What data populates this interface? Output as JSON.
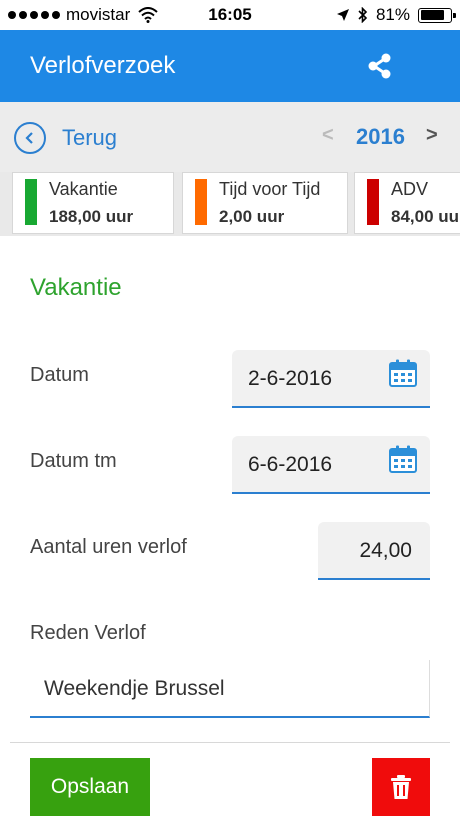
{
  "status_bar": {
    "carrier": "movistar",
    "time": "16:05",
    "battery": "81%",
    "battery_level": 0.81
  },
  "header": {
    "title": "Verlofverzoek",
    "share_icon": "share-icon"
  },
  "nav": {
    "back_label": "Terug",
    "year": "2016",
    "prev": "<",
    "next": ">"
  },
  "cards": [
    {
      "name": "Vakantie",
      "value": "188,00 uur",
      "color": "#18a832"
    },
    {
      "name": "Tijd voor Tijd",
      "value": "2,00 uur",
      "color": "#ff6a00"
    },
    {
      "name": "ADV",
      "value": "84,00 uur",
      "color": "#cc0000"
    }
  ],
  "form": {
    "section_title": "Vakantie",
    "datum_label": "Datum",
    "datum_value": "2-6-2016",
    "datum_tm_label": "Datum tm",
    "datum_tm_value": "6-6-2016",
    "uren_label": "Aantal uren verlof",
    "uren_value": "24,00",
    "reden_label": "Reden Verlof",
    "reden_value": "Weekendje Brussel"
  },
  "actions": {
    "save_label": "Opslaan",
    "delete_icon": "trash-icon"
  },
  "colors": {
    "header": "#1e88e5",
    "accent": "#2b7fd0",
    "section": "#2ea32e",
    "save": "#37a10f",
    "delete": "#f00c0c"
  }
}
